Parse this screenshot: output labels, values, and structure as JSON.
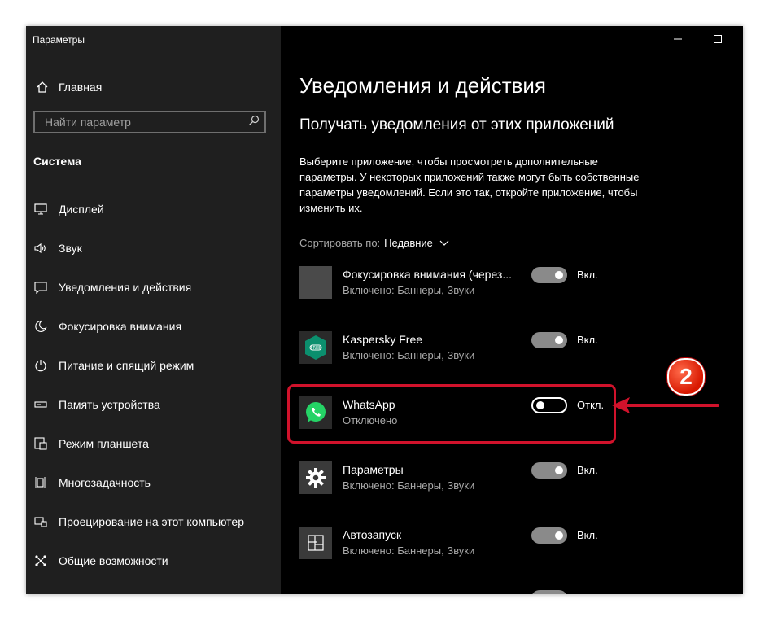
{
  "window": {
    "title": "Параметры",
    "controls": {
      "minimize": "—",
      "maximize": "☐",
      "close": "✕"
    }
  },
  "sidebar": {
    "home_label": "Главная",
    "search_placeholder": "Найти параметр",
    "section_title": "Система",
    "items": [
      {
        "label": "Дисплей",
        "icon": "monitor-icon"
      },
      {
        "label": "Звук",
        "icon": "speaker-icon"
      },
      {
        "label": "Уведомления и действия",
        "icon": "notification-icon"
      },
      {
        "label": "Фокусировка внимания",
        "icon": "moon-icon"
      },
      {
        "label": "Питание и спящий режим",
        "icon": "power-icon"
      },
      {
        "label": "Память устройства",
        "icon": "storage-icon"
      },
      {
        "label": "Режим планшета",
        "icon": "tablet-icon"
      },
      {
        "label": "Многозадачность",
        "icon": "multitask-icon"
      },
      {
        "label": "Проецирование на этот компьютер",
        "icon": "project-icon"
      },
      {
        "label": "Общие возможности",
        "icon": "shared-icon"
      }
    ]
  },
  "main": {
    "title": "Уведомления и действия",
    "subtitle": "Получать уведомления от этих приложений",
    "description": "Выберите приложение, чтобы просмотреть дополнительные параметры. У некоторых приложений также могут быть собственные параметры уведомлений. Если это так, откройте приложение, чтобы изменить их.",
    "sort_label": "Сортировать по:",
    "sort_value": "Недавние",
    "apps": [
      {
        "name": "Фокусировка внимания (через...",
        "status": "Включено: Баннеры, Звуки",
        "toggle_on": true,
        "toggle_label": "Вкл.",
        "icon": "focus-assist-icon",
        "icon_color": "#4a4a4a"
      },
      {
        "name": "Kaspersky Free",
        "status": "Включено: Баннеры, Звуки",
        "toggle_on": true,
        "toggle_label": "Вкл.",
        "icon": "kaspersky-icon",
        "icon_color": "#0b8f6e"
      },
      {
        "name": "WhatsApp",
        "status": "Отключено",
        "toggle_on": false,
        "toggle_label": "Откл.",
        "icon": "whatsapp-icon",
        "icon_color": "#25d366"
      },
      {
        "name": "Параметры",
        "status": "Включено: Баннеры, Звуки",
        "toggle_on": true,
        "toggle_label": "Вкл.",
        "icon": "gear-icon",
        "icon_color": "#3a3a3a"
      },
      {
        "name": "Автозапуск",
        "status": "Включено: Баннеры, Звуки",
        "toggle_on": true,
        "toggle_label": "Вкл.",
        "icon": "autoplay-icon",
        "icon_color": "#3a3a3a"
      }
    ]
  },
  "annotation": {
    "step_number": "2",
    "color": "#d0122b"
  }
}
